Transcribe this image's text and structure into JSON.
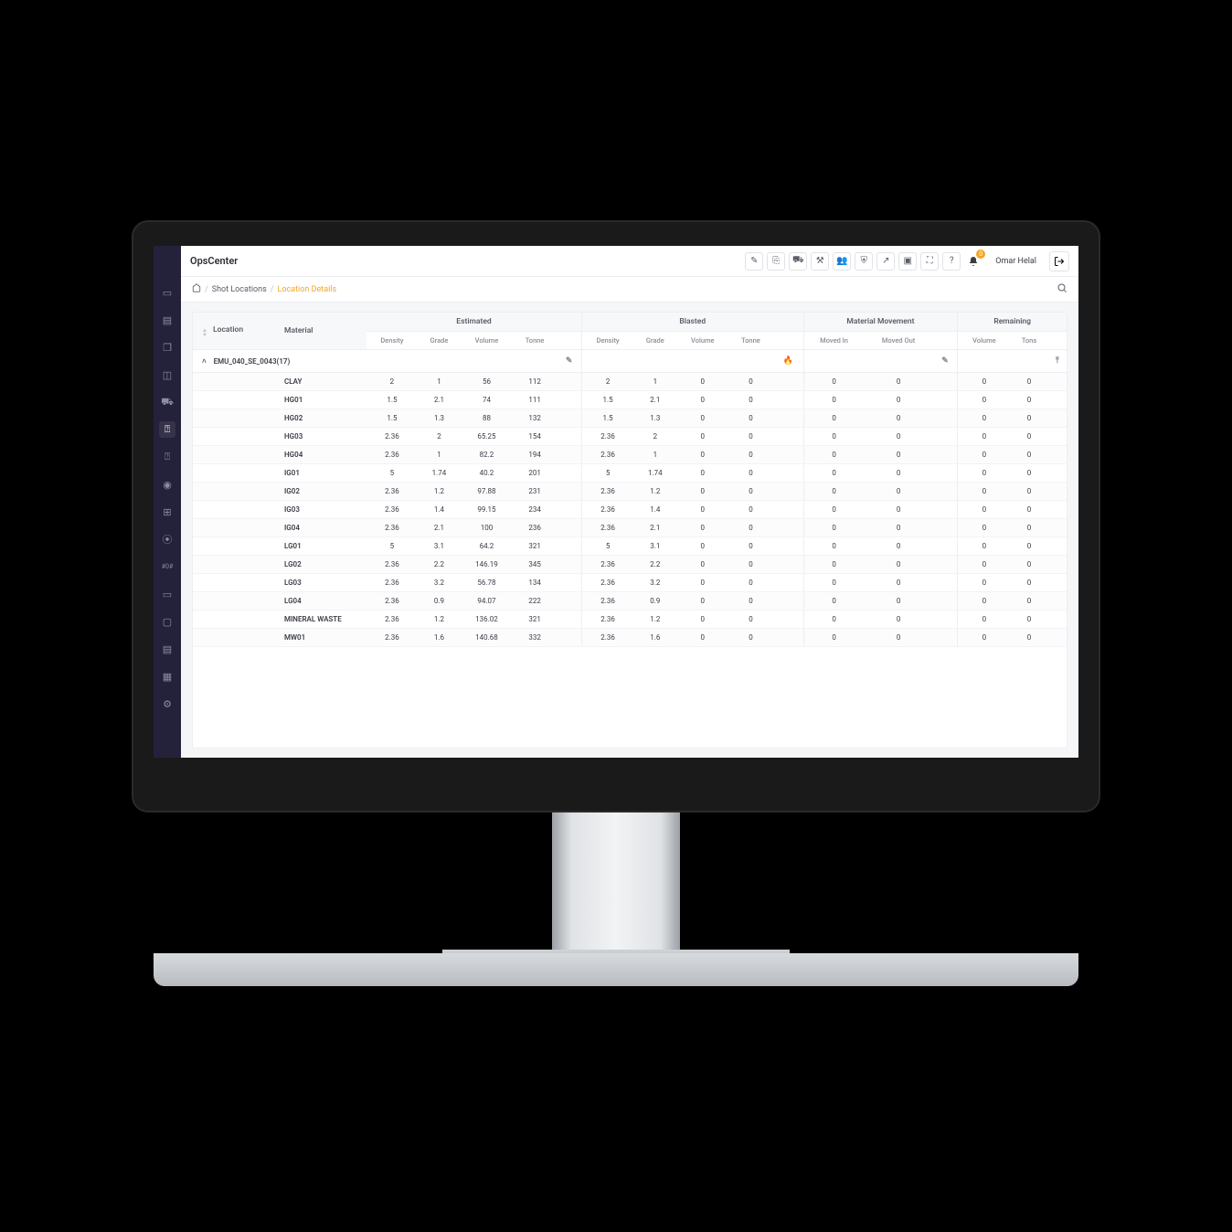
{
  "app_title": "OpsCenter",
  "user_name": "Omar Helal",
  "notification_count": "0",
  "breadcrumb": {
    "home_icon": "⌂",
    "level1": "Shot Locations",
    "current": "Location Details"
  },
  "table": {
    "headers": {
      "location": "Location",
      "material": "Material",
      "groups": {
        "estimated": "Estimated",
        "blasted": "Blasted",
        "movement": "Material Movement",
        "remaining": "Remaining"
      },
      "sub": {
        "density": "Density",
        "grade": "Grade",
        "volume": "Volume",
        "tonne": "Tonne",
        "moved_in": "Moved In",
        "moved_out": "Moved Out",
        "rem_volume": "Volume",
        "rem_tons": "Tons"
      }
    },
    "group_row": {
      "location": "EMU_040_SE_0043(17)"
    },
    "rows": [
      {
        "material": "CLAY",
        "est": {
          "density": "2",
          "grade": "1",
          "volume": "56",
          "tonne": "112"
        },
        "bl": {
          "density": "2",
          "grade": "1",
          "volume": "0",
          "tonne": "0"
        },
        "mv": {
          "in": "0",
          "out": "0"
        },
        "rem": {
          "vol": "0",
          "tons": "0"
        }
      },
      {
        "material": "HG01",
        "est": {
          "density": "1.5",
          "grade": "2.1",
          "volume": "74",
          "tonne": "111"
        },
        "bl": {
          "density": "1.5",
          "grade": "2.1",
          "volume": "0",
          "tonne": "0"
        },
        "mv": {
          "in": "0",
          "out": "0"
        },
        "rem": {
          "vol": "0",
          "tons": "0"
        }
      },
      {
        "material": "HG02",
        "est": {
          "density": "1.5",
          "grade": "1.3",
          "volume": "88",
          "tonne": "132"
        },
        "bl": {
          "density": "1.5",
          "grade": "1.3",
          "volume": "0",
          "tonne": "0"
        },
        "mv": {
          "in": "0",
          "out": "0"
        },
        "rem": {
          "vol": "0",
          "tons": "0"
        }
      },
      {
        "material": "HG03",
        "est": {
          "density": "2.36",
          "grade": "2",
          "volume": "65.25",
          "tonne": "154"
        },
        "bl": {
          "density": "2.36",
          "grade": "2",
          "volume": "0",
          "tonne": "0"
        },
        "mv": {
          "in": "0",
          "out": "0"
        },
        "rem": {
          "vol": "0",
          "tons": "0"
        }
      },
      {
        "material": "HG04",
        "est": {
          "density": "2.36",
          "grade": "1",
          "volume": "82.2",
          "tonne": "194"
        },
        "bl": {
          "density": "2.36",
          "grade": "1",
          "volume": "0",
          "tonne": "0"
        },
        "mv": {
          "in": "0",
          "out": "0"
        },
        "rem": {
          "vol": "0",
          "tons": "0"
        }
      },
      {
        "material": "IG01",
        "est": {
          "density": "5",
          "grade": "1.74",
          "volume": "40.2",
          "tonne": "201"
        },
        "bl": {
          "density": "5",
          "grade": "1.74",
          "volume": "0",
          "tonne": "0"
        },
        "mv": {
          "in": "0",
          "out": "0"
        },
        "rem": {
          "vol": "0",
          "tons": "0"
        }
      },
      {
        "material": "IG02",
        "est": {
          "density": "2.36",
          "grade": "1.2",
          "volume": "97.88",
          "tonne": "231"
        },
        "bl": {
          "density": "2.36",
          "grade": "1.2",
          "volume": "0",
          "tonne": "0"
        },
        "mv": {
          "in": "0",
          "out": "0"
        },
        "rem": {
          "vol": "0",
          "tons": "0"
        }
      },
      {
        "material": "IG03",
        "est": {
          "density": "2.36",
          "grade": "1.4",
          "volume": "99.15",
          "tonne": "234"
        },
        "bl": {
          "density": "2.36",
          "grade": "1.4",
          "volume": "0",
          "tonne": "0"
        },
        "mv": {
          "in": "0",
          "out": "0"
        },
        "rem": {
          "vol": "0",
          "tons": "0"
        }
      },
      {
        "material": "IG04",
        "est": {
          "density": "2.36",
          "grade": "2.1",
          "volume": "100",
          "tonne": "236"
        },
        "bl": {
          "density": "2.36",
          "grade": "2.1",
          "volume": "0",
          "tonne": "0"
        },
        "mv": {
          "in": "0",
          "out": "0"
        },
        "rem": {
          "vol": "0",
          "tons": "0"
        }
      },
      {
        "material": "LG01",
        "est": {
          "density": "5",
          "grade": "3.1",
          "volume": "64.2",
          "tonne": "321"
        },
        "bl": {
          "density": "5",
          "grade": "3.1",
          "volume": "0",
          "tonne": "0"
        },
        "mv": {
          "in": "0",
          "out": "0"
        },
        "rem": {
          "vol": "0",
          "tons": "0"
        }
      },
      {
        "material": "LG02",
        "est": {
          "density": "2.36",
          "grade": "2.2",
          "volume": "146.19",
          "tonne": "345"
        },
        "bl": {
          "density": "2.36",
          "grade": "2.2",
          "volume": "0",
          "tonne": "0"
        },
        "mv": {
          "in": "0",
          "out": "0"
        },
        "rem": {
          "vol": "0",
          "tons": "0"
        }
      },
      {
        "material": "LG03",
        "est": {
          "density": "2.36",
          "grade": "3.2",
          "volume": "56.78",
          "tonne": "134"
        },
        "bl": {
          "density": "2.36",
          "grade": "3.2",
          "volume": "0",
          "tonne": "0"
        },
        "mv": {
          "in": "0",
          "out": "0"
        },
        "rem": {
          "vol": "0",
          "tons": "0"
        }
      },
      {
        "material": "LG04",
        "est": {
          "density": "2.36",
          "grade": "0.9",
          "volume": "94.07",
          "tonne": "222"
        },
        "bl": {
          "density": "2.36",
          "grade": "0.9",
          "volume": "0",
          "tonne": "0"
        },
        "mv": {
          "in": "0",
          "out": "0"
        },
        "rem": {
          "vol": "0",
          "tons": "0"
        }
      },
      {
        "material": "MINERAL WASTE",
        "est": {
          "density": "2.36",
          "grade": "1.2",
          "volume": "136.02",
          "tonne": "321"
        },
        "bl": {
          "density": "2.36",
          "grade": "1.2",
          "volume": "0",
          "tonne": "0"
        },
        "mv": {
          "in": "0",
          "out": "0"
        },
        "rem": {
          "vol": "0",
          "tons": "0"
        }
      },
      {
        "material": "MW01",
        "est": {
          "density": "2.36",
          "grade": "1.6",
          "volume": "140.68",
          "tonne": "332"
        },
        "bl": {
          "density": "2.36",
          "grade": "1.6",
          "volume": "0",
          "tonne": "0"
        },
        "mv": {
          "in": "0",
          "out": "0"
        },
        "rem": {
          "vol": "0",
          "tons": "0"
        }
      }
    ]
  }
}
